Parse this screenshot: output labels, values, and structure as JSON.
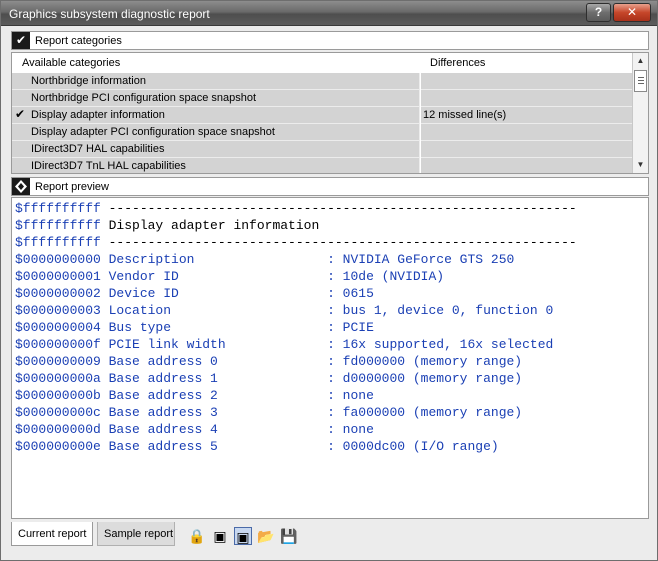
{
  "window": {
    "title": "Graphics subsystem diagnostic report",
    "help_label": "?",
    "close_label": "✕"
  },
  "categories_section": {
    "label": "Report categories",
    "check_glyph": "✔"
  },
  "list": {
    "col_available": "Available categories",
    "col_differences": "Differences",
    "rows": [
      {
        "name": "Northbridge information",
        "diff": "",
        "checked": false
      },
      {
        "name": "Northbridge PCI configuration space snapshot",
        "diff": "",
        "checked": false
      },
      {
        "name": "Display adapter information",
        "diff": "12 missed line(s)",
        "checked": true
      },
      {
        "name": "Display adapter PCI configuration space snapshot",
        "diff": "",
        "checked": false
      },
      {
        "name": "IDirect3D7 HAL capabilities",
        "diff": "",
        "checked": false
      },
      {
        "name": "IDirect3D7 TnL HAL capabilities",
        "diff": "",
        "checked": false
      }
    ],
    "tick_glyph": "✔"
  },
  "preview_section": {
    "label": "Report preview"
  },
  "preview": {
    "lines": [
      {
        "addr": "$ffffffffff",
        "text": " ------------------------------------------------------------"
      },
      {
        "addr": "$ffffffffff",
        "text": " Display adapter information"
      },
      {
        "addr": "$ffffffffff",
        "text": " ------------------------------------------------------------"
      },
      {
        "addr": "$0000000000",
        "text": " Description                 : NVIDIA GeForce GTS 250"
      },
      {
        "addr": "$0000000001",
        "text": " Vendor ID                   : 10de (NVIDIA)"
      },
      {
        "addr": "$0000000002",
        "text": " Device ID                   : 0615"
      },
      {
        "addr": "$0000000003",
        "text": " Location                    : bus 1, device 0, function 0"
      },
      {
        "addr": "$0000000004",
        "text": " Bus type                    : PCIE"
      },
      {
        "addr": "$000000000f",
        "text": " PCIE link width             : 16x supported, 16x selected"
      },
      {
        "addr": "$0000000009",
        "text": " Base address 0              : fd000000 (memory range)"
      },
      {
        "addr": "$000000000a",
        "text": " Base address 1              : d0000000 (memory range)"
      },
      {
        "addr": "$000000000b",
        "text": " Base address 2              : none"
      },
      {
        "addr": "$000000000c",
        "text": " Base address 3              : fa000000 (memory range)"
      },
      {
        "addr": "$000000000d",
        "text": " Base address 4              : none"
      },
      {
        "addr": "$000000000e",
        "text": " Base address 5              : 0000dc00 (I/O range)"
      }
    ]
  },
  "tabs": {
    "current": "Current report",
    "sample": "Sample report"
  },
  "toolbar": {
    "lock_glyph": "🔒",
    "compare_glyph": "▣",
    "compare_sel_glyph": "▣",
    "open_glyph": "📂",
    "save_glyph": "💾"
  }
}
